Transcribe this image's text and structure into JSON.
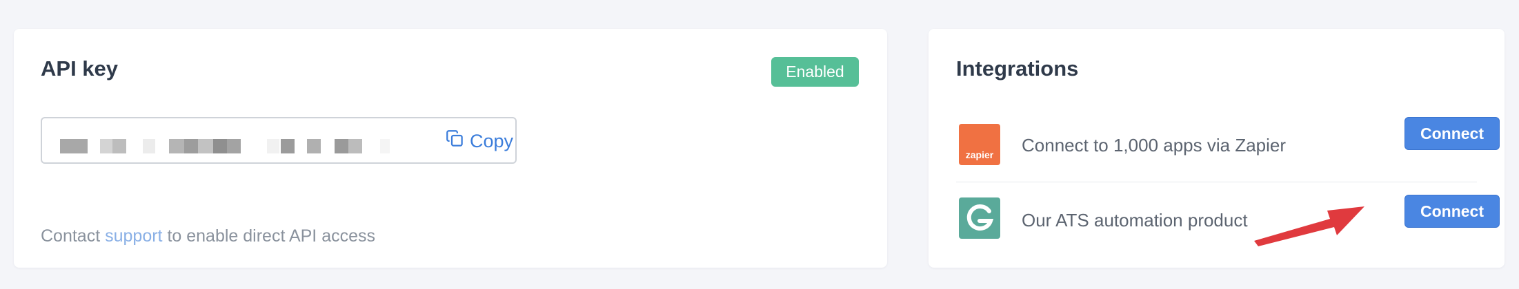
{
  "api_key": {
    "title": "API key",
    "status_badge": "Enabled",
    "copy_label": "Copy",
    "contact_prefix": "Contact ",
    "contact_link": "support",
    "contact_suffix": " to enable direct API access"
  },
  "integrations": {
    "title": "Integrations",
    "items": [
      {
        "logo_text": "zapier",
        "label": "Connect to 1,000 apps via Zapier",
        "button": "Connect",
        "icon": "zapier-logo"
      },
      {
        "logo_text": "",
        "label": "Our ATS automation product",
        "button": "Connect",
        "icon": "ats-logo"
      }
    ]
  },
  "colors": {
    "badge": "#56bf97",
    "primary_button": "#4a86e2",
    "link": "#3b7ddb",
    "arrow_annotation": "#e03a3e",
    "zapier": "#f07142",
    "ats": "#5aaa9a"
  },
  "annotation": "red-arrow-icon"
}
